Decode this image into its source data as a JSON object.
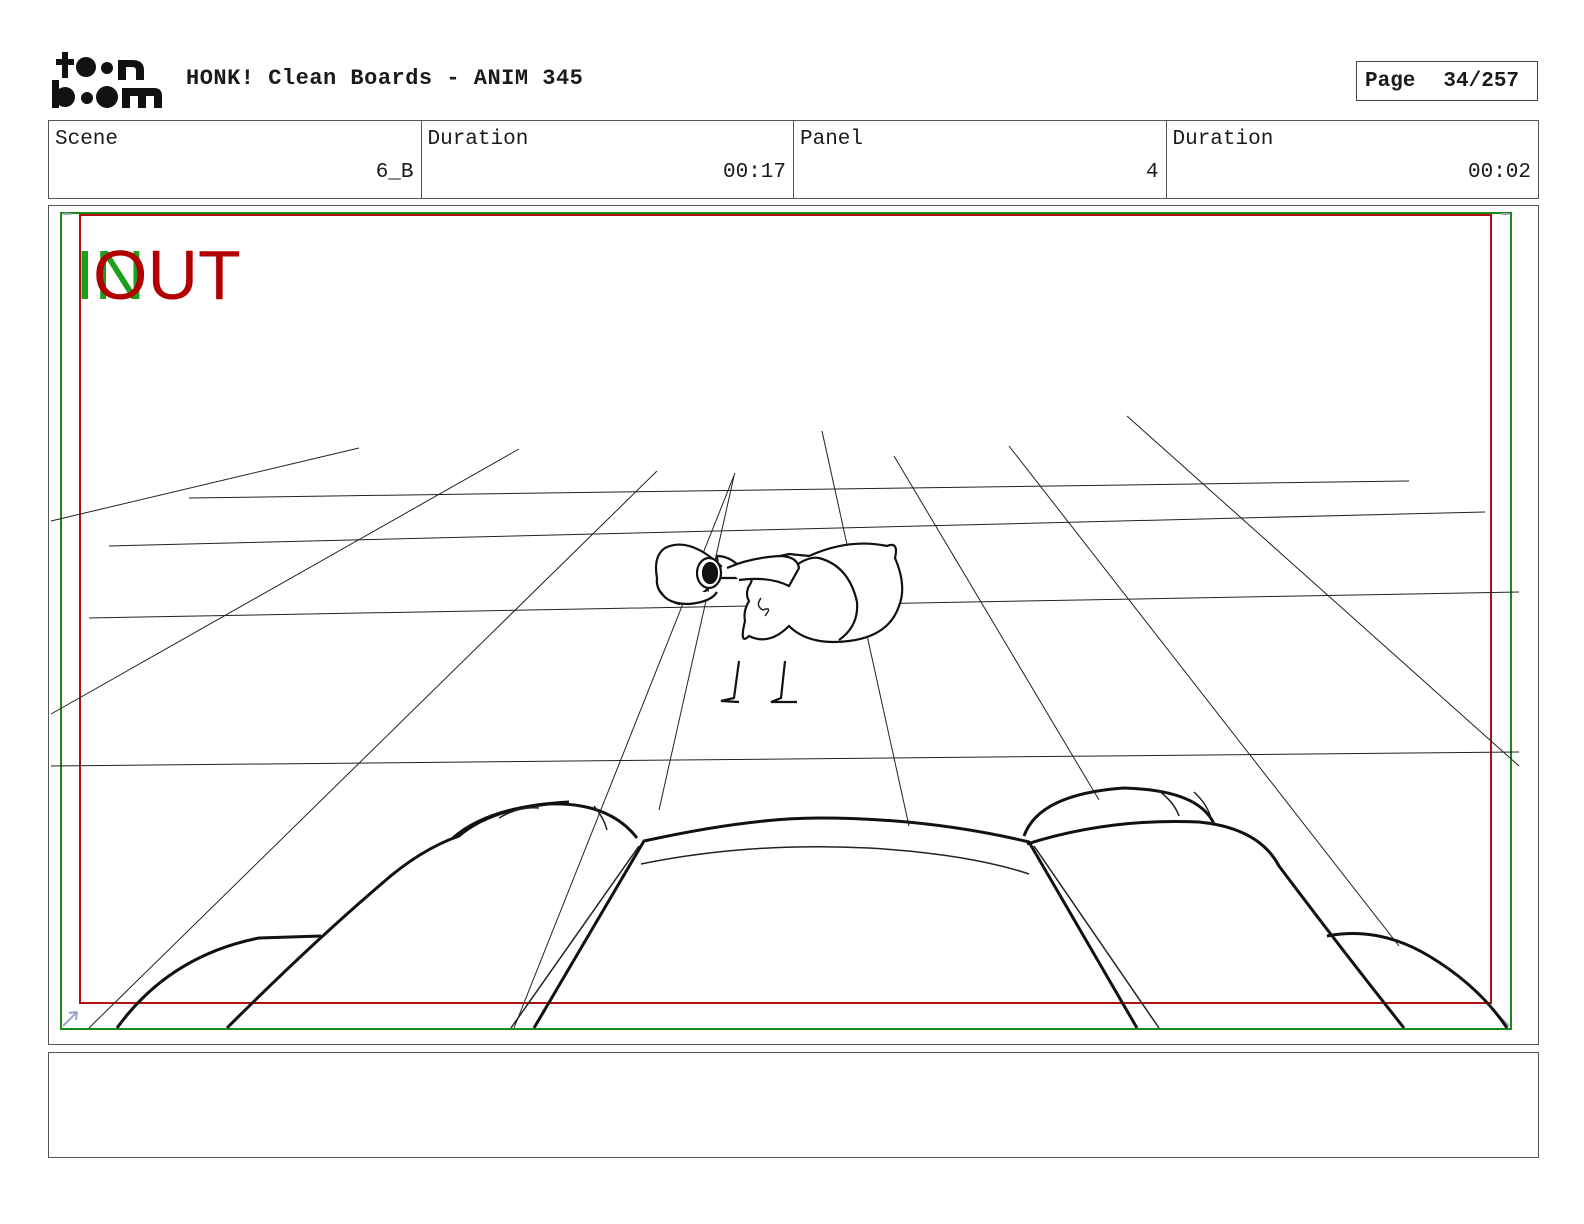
{
  "header": {
    "logo_text": "toon boom",
    "title": "HONK! Clean Boards - ANIM 345",
    "page_label": "Page",
    "page_value": "34/257"
  },
  "info": {
    "scene_label": "Scene",
    "scene_value": "6_B",
    "scene_duration_label": "Duration",
    "scene_duration_value": "00:17",
    "panel_label": "Panel",
    "panel_value": "4",
    "panel_duration_label": "Duration",
    "panel_duration_value": "00:02"
  },
  "panel": {
    "in_label": "IN",
    "out_label": "OUT",
    "colors": {
      "safe_area": "#1a8a1a",
      "action_area": "#b01010",
      "in_text": "#1aa01a",
      "out_text": "#b00000"
    }
  },
  "notes": {
    "text": ""
  }
}
